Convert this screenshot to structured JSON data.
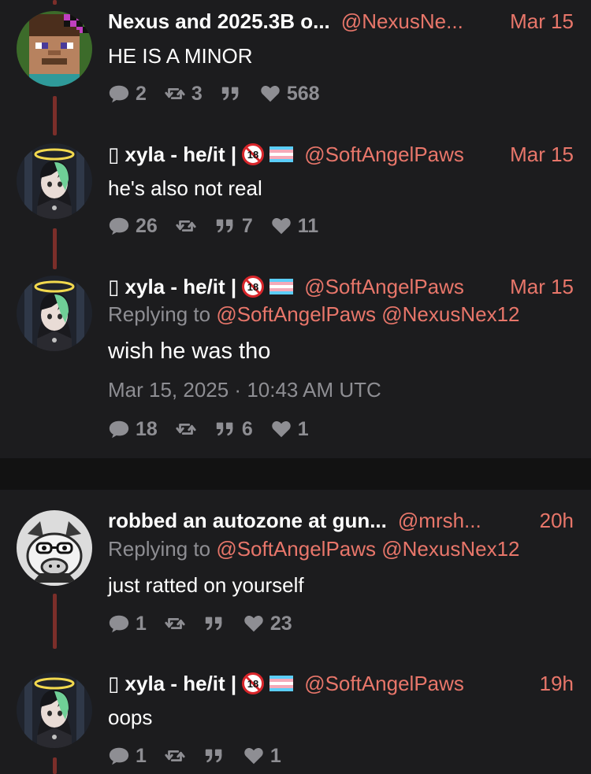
{
  "colors": {
    "accent": "#e8766a",
    "background": "#1c1c1e",
    "muted": "#8e8e93",
    "thread_line": "#7b2e2a"
  },
  "tweets": [
    {
      "name": "Nexus and 2025.3B o...",
      "handle": "@NexusNe...",
      "date": "Mar 15",
      "text": "HE IS A MINOR",
      "stats": {
        "replies": "2",
        "retweets": "3",
        "quotes": "",
        "likes": "568"
      }
    },
    {
      "name": "▯ xyla - he/it |",
      "handle": "@SoftAngelPaws",
      "date": "Mar 15",
      "text": "he's also not real",
      "stats": {
        "replies": "26",
        "retweets": "",
        "quotes": "7",
        "likes": "11"
      }
    },
    {
      "name": "▯ xyla - he/it |",
      "handle": "@SoftAngelPaws",
      "date": "Mar 15",
      "replying_prefix": "Replying to",
      "replying_to": [
        "@SoftAngelPaws",
        "@NexusNex12"
      ],
      "text": "wish he was tho",
      "timestamp": "Mar 15, 2025 · 10:43 AM UTC",
      "stats": {
        "replies": "18",
        "retweets": "",
        "quotes": "6",
        "likes": "1"
      }
    },
    {
      "name": "robbed an autozone at gun...",
      "handle": "@mrsh...",
      "date": "20h",
      "replying_prefix": "Replying to",
      "replying_to": [
        "@SoftAngelPaws",
        "@NexusNex12"
      ],
      "text": "just ratted on yourself",
      "stats": {
        "replies": "1",
        "retweets": "",
        "quotes": "",
        "likes": "23"
      }
    },
    {
      "name": "▯ xyla - he/it |",
      "handle": "@SoftAngelPaws",
      "date": "19h",
      "text": "oops",
      "stats": {
        "replies": "1",
        "retweets": "",
        "quotes": "",
        "likes": "1"
      }
    }
  ],
  "icons": [
    "reply-icon",
    "retweet-icon",
    "quote-icon",
    "heart-icon",
    "no-minors-18-badge-icon",
    "trans-flag-icon"
  ]
}
